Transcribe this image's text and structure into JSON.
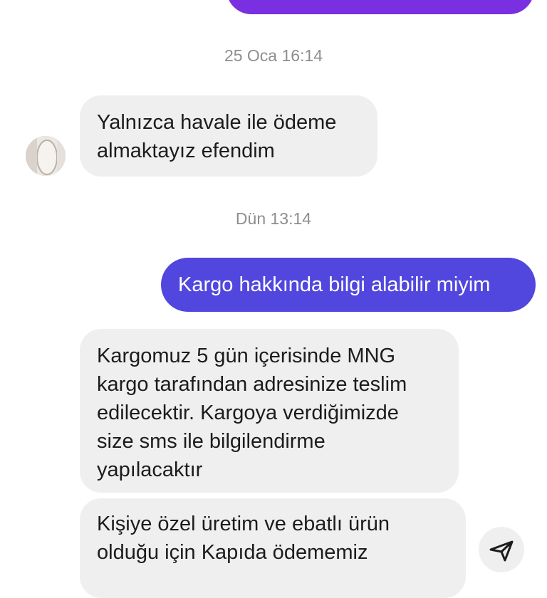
{
  "colors": {
    "outgoing_top": "#7a2fe0",
    "outgoing_bottom": "#5147de",
    "incoming": "#efefef",
    "timestamp": "#8e8e8e"
  },
  "timestamps": [
    "25 Oca 16:14",
    "Dün 13:14"
  ],
  "messages": [
    {
      "from": "me",
      "text": ""
    },
    {
      "from": "them",
      "lines": [
        "Yalnızca havale ile ödeme",
        "almaktayız efendim"
      ]
    },
    {
      "from": "me",
      "text": "Kargo hakkında bilgi alabilir miyim"
    },
    {
      "from": "them",
      "lines": [
        "Kargomuz 5 gün içerisinde MNG",
        "kargo tarafından adresinize teslim",
        "edilecektir. Kargoya verdiğimizde",
        "size sms ile bilgilendirme",
        "yapılacaktır"
      ]
    },
    {
      "from": "them",
      "lines": [
        "Kişiye özel üretim ve ebatlı ürün",
        "olduğu için Kapıda ödememiz"
      ]
    }
  ],
  "icons": {
    "avatar": "avatar",
    "share": "share-icon"
  }
}
